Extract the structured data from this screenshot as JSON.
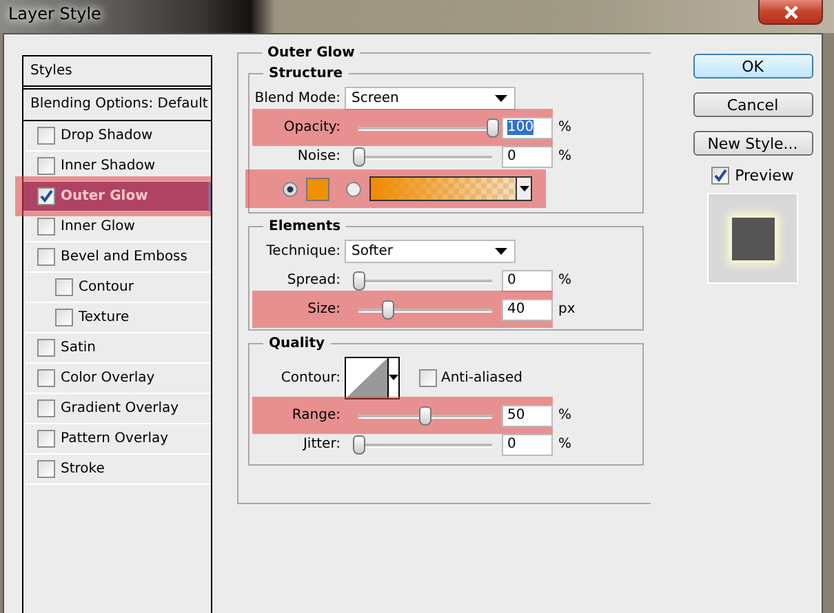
{
  "window": {
    "title": "Layer Style"
  },
  "styles_panel": {
    "header": "Styles",
    "blending": "Blending Options: Default",
    "items": [
      {
        "label": "Drop Shadow",
        "checked": false,
        "selected": false,
        "highlighted": false
      },
      {
        "label": "Inner Shadow",
        "checked": false,
        "selected": false,
        "highlighted": false
      },
      {
        "label": "Outer Glow",
        "checked": true,
        "selected": true,
        "highlighted": true
      },
      {
        "label": "Inner Glow",
        "checked": false,
        "selected": false,
        "highlighted": false
      },
      {
        "label": "Bevel and Emboss",
        "checked": false,
        "selected": false,
        "highlighted": false,
        "children": [
          {
            "label": "Contour",
            "checked": false,
            "selected": false,
            "highlighted": false
          },
          {
            "label": "Texture",
            "checked": false,
            "selected": false,
            "highlighted": false
          }
        ]
      },
      {
        "label": "Satin",
        "checked": false,
        "selected": false,
        "highlighted": false
      },
      {
        "label": "Color Overlay",
        "checked": false,
        "selected": false,
        "highlighted": false
      },
      {
        "label": "Gradient Overlay",
        "checked": false,
        "selected": false,
        "highlighted": false
      },
      {
        "label": "Pattern Overlay",
        "checked": false,
        "selected": false,
        "highlighted": false
      },
      {
        "label": "Stroke",
        "checked": false,
        "selected": false,
        "highlighted": false
      }
    ]
  },
  "effect": {
    "title": "Outer Glow",
    "sections": [
      {
        "title": "Structure",
        "rows": [
          {
            "kind": "dropdown",
            "label": "Blend Mode:",
            "value": "Screen"
          },
          {
            "kind": "slider",
            "label": "Opacity:",
            "level": 1,
            "value": "100",
            "unit": "%",
            "highlighted": true,
            "value_selected": true
          },
          {
            "kind": "slider",
            "label": "Noise:",
            "level": 0,
            "value": "0",
            "unit": "%",
            "highlighted": false,
            "value_selected": false
          },
          {
            "kind": "fill",
            "highlighted": true,
            "options": [
              {
                "kind": "solid",
                "selected": true
              },
              {
                "kind": "gradient",
                "selected": false
              }
            ]
          }
        ]
      },
      {
        "title": "Elements",
        "rows": [
          {
            "kind": "dropdown",
            "label": "Technique:",
            "value": "Softer"
          },
          {
            "kind": "slider",
            "label": "Spread:",
            "level": 0,
            "value": "0",
            "unit": "%",
            "highlighted": false,
            "value_selected": false
          },
          {
            "kind": "slider",
            "label": "Size:",
            "level": 0.22,
            "value": "40",
            "unit": "px",
            "highlighted": true,
            "value_selected": false
          }
        ]
      },
      {
        "title": "Quality",
        "rows": [
          {
            "kind": "contour",
            "label": "Contour:",
            "checkbox_label": "Anti-aliased",
            "checked": false
          },
          {
            "kind": "slider",
            "label": "Range:",
            "level": 0.5,
            "value": "50",
            "unit": "%",
            "highlighted": true,
            "value_selected": false
          },
          {
            "kind": "slider",
            "label": "Jitter:",
            "level": 0,
            "value": "0",
            "unit": "%",
            "highlighted": false,
            "value_selected": false
          }
        ]
      }
    ]
  },
  "buttons": [
    {
      "label": "OK",
      "default": true
    },
    {
      "label": "Cancel",
      "default": false
    },
    {
      "label": "New Style...",
      "default": false
    }
  ],
  "preview": {
    "label": "Preview",
    "checked": true
  }
}
